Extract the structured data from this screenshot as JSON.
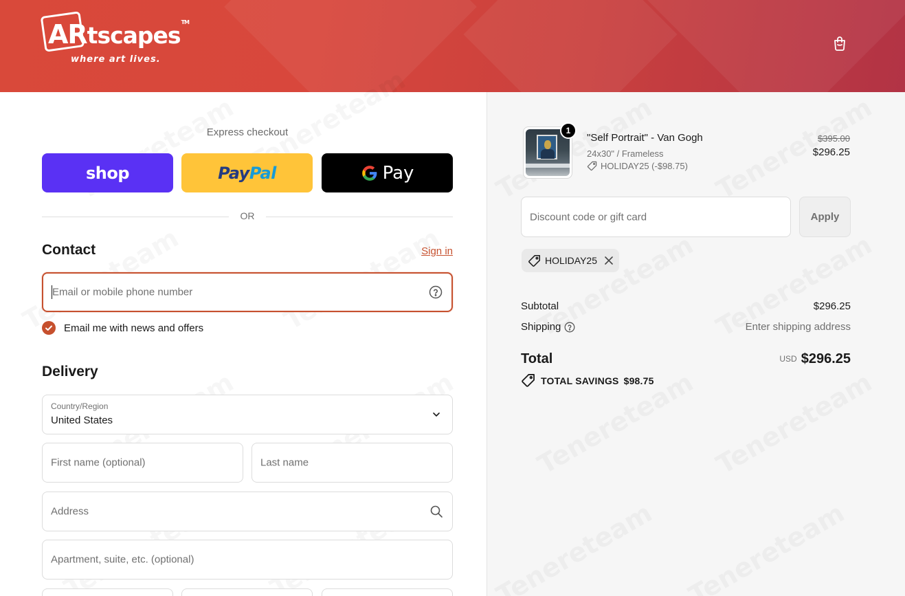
{
  "brand": {
    "logo_word_main": "AR",
    "logo_word_rest": "tscapes",
    "logo_tm": "TM",
    "tagline": "where art lives."
  },
  "header": {
    "cart_icon": "shopping-bag-icon"
  },
  "express": {
    "label": "Express checkout",
    "shop_label": "shop",
    "paypal_label_1": "Pay",
    "paypal_label_2": "Pal",
    "gpay_label": "Pay",
    "or_label": "OR"
  },
  "contact": {
    "title": "Contact",
    "signin_label": "Sign in",
    "email_placeholder": "Email or mobile phone number",
    "newsletter_label": "Email me with news and offers",
    "newsletter_checked": true
  },
  "delivery": {
    "title": "Delivery",
    "country_label": "Country/Region",
    "country_value": "United States",
    "first_name_placeholder": "First name (optional)",
    "last_name_placeholder": "Last name",
    "address_placeholder": "Address",
    "apartment_placeholder": "Apartment, suite, etc. (optional)"
  },
  "cart": {
    "item": {
      "quantity": "1",
      "title": "\"Self Portrait\" - Van Gogh",
      "variant": "24x30\" / Frameless",
      "discount": "HOLIDAY25 (-$98.75)",
      "original_price": "$395.00",
      "price": "$296.25"
    },
    "discount_placeholder": "Discount code or gift card",
    "apply_label": "Apply",
    "applied_code": "HOLIDAY25",
    "subtotal_label": "Subtotal",
    "subtotal_value": "$296.25",
    "shipping_label": "Shipping",
    "shipping_value": "Enter shipping address",
    "total_label": "Total",
    "currency": "USD",
    "total_value": "$296.25",
    "savings_label": "TOTAL SAVINGS",
    "savings_value": "$98.75"
  },
  "colors": {
    "accent": "#c6502e",
    "shop_purple": "#5a31f4",
    "paypal_yellow": "#ffc439",
    "header_red": "#d9493a"
  }
}
